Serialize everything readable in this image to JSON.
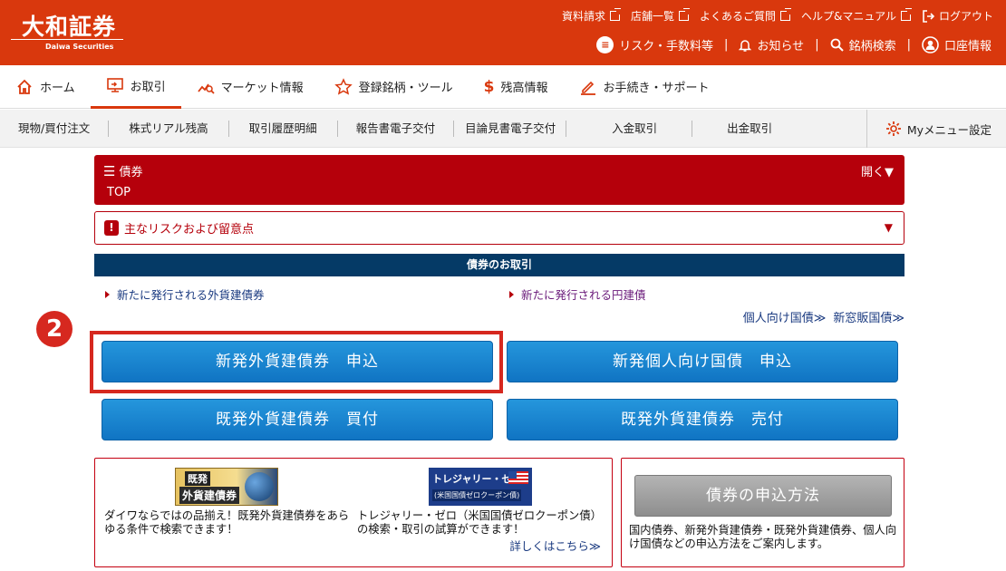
{
  "brand": {
    "logo_jp": "大和証券",
    "logo_en": "Daiwa Securities"
  },
  "top_links": [
    "資料請求",
    "店舗一覧",
    "よくあるご質問",
    "ヘルプ&マニュアル",
    "ログアウト"
  ],
  "top_links2": [
    "リスク・手数料等",
    "お知らせ",
    "銘柄検索",
    "口座情報"
  ],
  "nav": [
    "ホーム",
    "お取引",
    "マーケット情報",
    "登録銘柄・ツール",
    "残高情報",
    "お手続き・サポート"
  ],
  "subnav": [
    "現物/買付注文",
    "株式リアル残高",
    "取引履歴明細",
    "報告書電子交付",
    "目論見書電子交付",
    "入金取引",
    "出金取引"
  ],
  "mymenu": "Myメニュー設定",
  "section": {
    "title": "債券",
    "sub": "TOP",
    "open": "開く▼"
  },
  "risk": "主なリスクおよび留意点",
  "deal_header": "債券のお取引",
  "links": {
    "left": "新たに発行される外貨建債券",
    "right": "新たに発行される円建債",
    "kojin": "個人向け国債≫",
    "shinmado": "新窓販国債≫"
  },
  "step": "2",
  "buttons": [
    "新発外貨建債券　申込",
    "新発個人向け国債　申込",
    "既発外貨建債券　買付",
    "既発外貨建債券　売付"
  ],
  "banner1": {
    "badge": "既発",
    "title": "外貨建債券",
    "desc": "ダイワならではの品揃え！既発外貨建債券をあらゆる条件で検索できます！"
  },
  "banner2": {
    "title": "トレジャリー・ゼロ",
    "sub": "(米国国債ゼロクーポン債)",
    "desc": "トレジャリー・ゼロ（米国国債ゼロクーポン債）の検索・取引の試算ができます！",
    "more": "詳しくはこちら≫"
  },
  "apply": {
    "button": "債券の申込方法",
    "desc": "国内債券、新発外貨建債券・既発外貨建債券、個人向け国債などの申込方法をご案内します。"
  }
}
